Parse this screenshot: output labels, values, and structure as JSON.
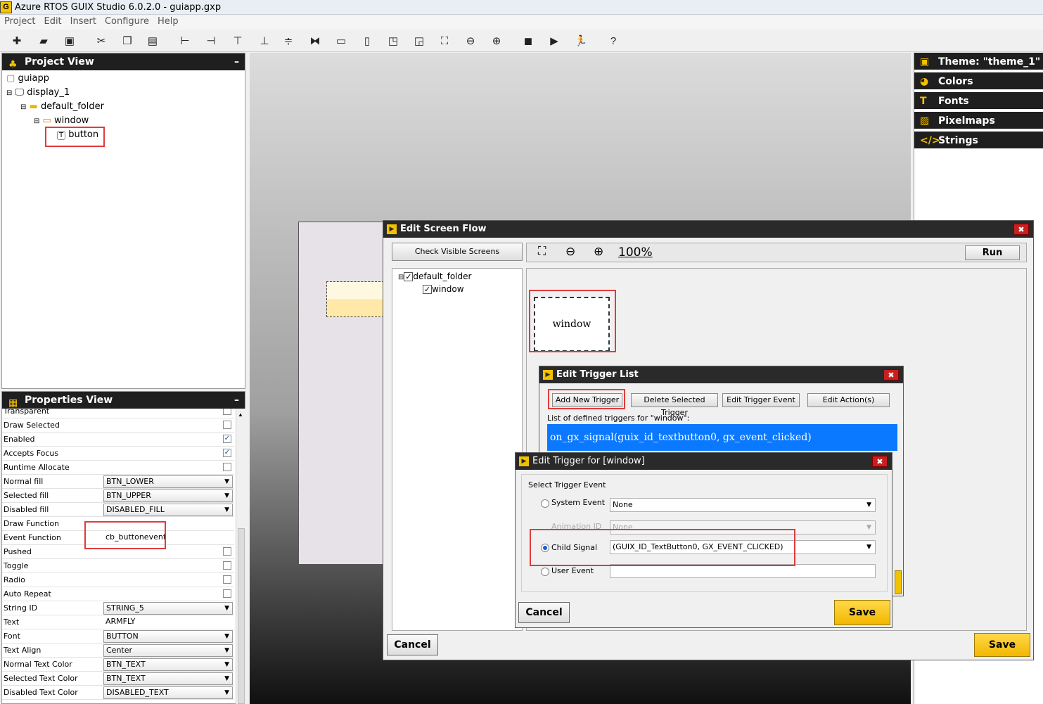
{
  "window": {
    "title": "Azure RTOS GUIX Studio 6.0.2.0 - guiapp.gxp",
    "logo": "G"
  },
  "menu": [
    "Project",
    "Edit",
    "Insert",
    "Configure",
    "Help"
  ],
  "toolbar_icons": [
    "new-icon",
    "open-icon",
    "save-icon",
    "cut-icon",
    "copy-icon",
    "paste-icon",
    "align-left-icon",
    "align-right-icon",
    "align-top-icon",
    "align-bottom-icon",
    "v-center-icon",
    "h-center-icon",
    "equal-width-icon",
    "equal-height-icon",
    "move-front-icon",
    "move-back-icon",
    "size-to-fit-icon",
    "zoom-out-icon",
    "zoom-in-icon",
    "record-icon",
    "run-icon",
    "runner-icon",
    "help-icon"
  ],
  "project_view": {
    "title": "Project View",
    "tree": [
      "guiapp",
      "display_1",
      "default_folder",
      "window",
      "button"
    ]
  },
  "properties_view": {
    "title": "Properties View",
    "rows": [
      {
        "label": "Transparent",
        "type": "check",
        "checked": ""
      },
      {
        "label": "Draw Selected",
        "type": "check",
        "checked": ""
      },
      {
        "label": "Enabled",
        "type": "check",
        "checked": "✓"
      },
      {
        "label": "Accepts Focus",
        "type": "check",
        "checked": "✓"
      },
      {
        "label": "Runtime Allocate",
        "type": "check",
        "checked": ""
      },
      {
        "label": "Normal fill",
        "type": "dd",
        "value": "BTN_LOWER"
      },
      {
        "label": "Selected fill",
        "type": "dd",
        "value": "BTN_UPPER"
      },
      {
        "label": "Disabled fill",
        "type": "dd",
        "value": "DISABLED_FILL"
      },
      {
        "label": "Draw Function",
        "type": "text",
        "value": ""
      },
      {
        "label": "Event Function",
        "type": "text",
        "value": "cb_buttonevent"
      },
      {
        "label": "Pushed",
        "type": "check",
        "checked": ""
      },
      {
        "label": "Toggle",
        "type": "check",
        "checked": ""
      },
      {
        "label": "Radio",
        "type": "check",
        "checked": ""
      },
      {
        "label": "Auto Repeat",
        "type": "check",
        "checked": ""
      },
      {
        "label": "String ID",
        "type": "dd",
        "value": "STRING_5"
      },
      {
        "label": "Text",
        "type": "text",
        "value": "ARMFLY"
      },
      {
        "label": "Font",
        "type": "dd",
        "value": "BUTTON"
      },
      {
        "label": "Text Align",
        "type": "dd",
        "value": "Center"
      },
      {
        "label": "Normal Text Color",
        "type": "dd",
        "value": "BTN_TEXT"
      },
      {
        "label": "Selected Text Color",
        "type": "dd",
        "value": "BTN_TEXT"
      },
      {
        "label": "Disabled Text Color",
        "type": "dd",
        "value": "DISABLED_TEXT"
      }
    ]
  },
  "resources": {
    "theme": "Theme: \"theme_1\"",
    "items": [
      "Colors",
      "Fonts",
      "Pixelmaps",
      "Strings"
    ]
  },
  "screen_flow": {
    "title": "Edit Screen Flow",
    "check_visible": "Check Visible Screens",
    "zoom": "100%",
    "run": "Run",
    "tree": [
      "default_folder",
      "window"
    ],
    "screen_node": "window",
    "cancel": "Cancel",
    "save": "Save"
  },
  "trigger_list": {
    "title": "Edit Trigger List",
    "buttons": [
      "Add New Trigger",
      "Delete Selected Trigger",
      "Edit Trigger Event",
      "Edit Action(s)"
    ],
    "list_label": "List of defined triggers for \"window\":",
    "selected": "on_gx_signal(guix_id_textbutton0, gx_event_clicked)"
  },
  "trigger_edit": {
    "title": "Edit Trigger for [window]",
    "group_label": "Select Trigger Event",
    "system_event_label": "System Event",
    "system_event_value": "None",
    "animation_id_label": "Animation ID",
    "animation_id_value": "None",
    "child_signal_label": "Child Signal",
    "child_signal_value": "(GUIX_ID_TextButton0, GX_EVENT_CLICKED)",
    "user_event_label": "User Event",
    "user_event_value": "",
    "cancel": "Cancel",
    "save": "Save"
  },
  "colors": {
    "accent": "#f2c200",
    "header_bg": "#1f1f1f",
    "selection": "#0a78ff",
    "highlight": "#e03c3c"
  }
}
